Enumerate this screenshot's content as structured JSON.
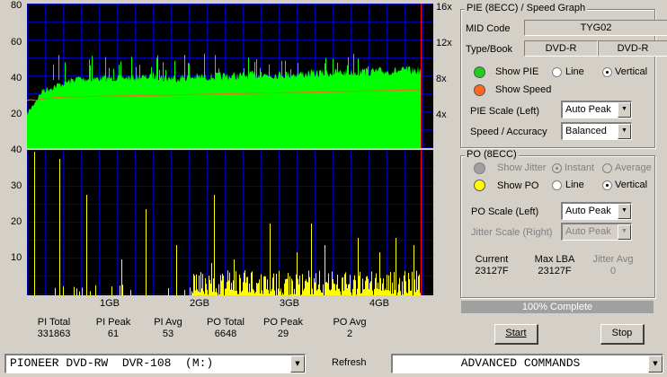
{
  "pie_graph": {
    "left_axis": [
      "80",
      "60",
      "40",
      "20"
    ],
    "right_axis": [
      "16x",
      "12x",
      "8x",
      "4x"
    ]
  },
  "po_graph": {
    "left_axis": [
      "40",
      "30",
      "20",
      "10"
    ],
    "x_axis": [
      "1GB",
      "2GB",
      "3GB",
      "4GB"
    ]
  },
  "stats": {
    "pi_total_label": "PI Total",
    "pi_total": "331863",
    "pi_peak_label": "PI Peak",
    "pi_peak": "61",
    "pi_avg_label": "PI Avg",
    "pi_avg": "53",
    "po_total_label": "PO Total",
    "po_total": "6648",
    "po_peak_label": "PO Peak",
    "po_peak": "29",
    "po_avg_label": "PO Avg",
    "po_avg": "2"
  },
  "pie_panel": {
    "title": "PIE (8ECC) / Speed Graph",
    "mid_code_label": "MID Code",
    "mid_code": "TYG02",
    "type_book_label": "Type/Book",
    "type": "DVD-R",
    "book": "DVD-R",
    "show_pie_label": "Show PIE",
    "show_pie_color": "#22cc22",
    "line_label": "Line",
    "vertical_label": "Vertical",
    "show_speed_label": "Show Speed",
    "show_speed_color": "#ff6622",
    "pie_scale_label": "PIE Scale (Left)",
    "pie_scale_value": "Auto Peak",
    "speed_accuracy_label": "Speed / Accuracy",
    "speed_accuracy_value": "Balanced"
  },
  "po_panel": {
    "title": "PO (8ECC)",
    "show_jitter_label": "Show Jitter",
    "instant_label": "Instant",
    "average_label": "Average",
    "show_po_label": "Show PO",
    "show_po_color": "#ffff00",
    "line_label": "Line",
    "vertical_label": "Vertical",
    "po_scale_label": "PO Scale (Left)",
    "po_scale_value": "Auto Peak",
    "jitter_scale_label": "Jitter Scale (Right)",
    "jitter_scale_value": "Auto Peak",
    "current_label": "Current",
    "current_value": "23127F",
    "max_lba_label": "Max LBA",
    "max_lba_value": "23127F",
    "jitter_avg_label": "Jitter Avg",
    "jitter_avg_value": "0"
  },
  "progress": {
    "text": "100% Complete",
    "fraction": 1.0
  },
  "buttons": {
    "start": "Start",
    "stop": "Stop",
    "refresh": "Refresh"
  },
  "drive_select": {
    "value": "PIONEER DVD-RW  DVR-108  (M:)"
  },
  "advanced_select": {
    "value": "ADVANCED COMMANDS"
  },
  "colors": {
    "grid": "#0000aa",
    "pie_fill": "#00ff00",
    "speed_line": "#ff6622",
    "po_fill": "#ffff00",
    "end_marker": "#ff0000"
  }
}
